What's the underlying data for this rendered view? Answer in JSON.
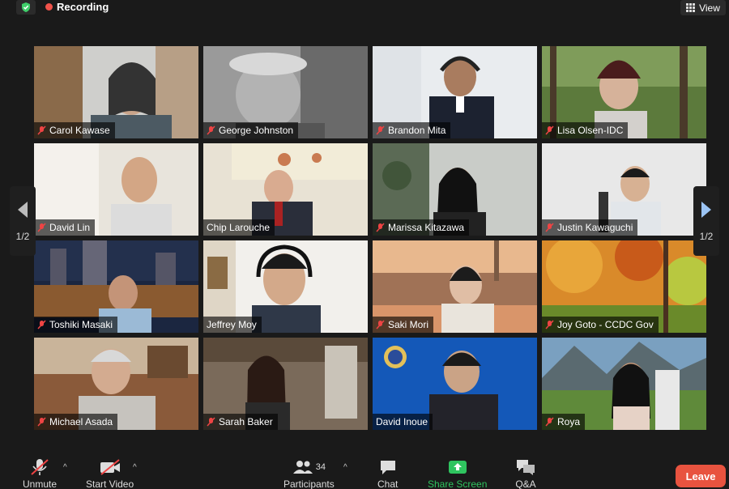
{
  "topbar": {
    "recording_label": "Recording",
    "view_label": "View",
    "security_icon": "shield-check-icon"
  },
  "pagination": {
    "left": "1/2",
    "right": "1/2"
  },
  "participants_grid": [
    {
      "name": "Carol Kawase",
      "muted": true
    },
    {
      "name": "George Johnston",
      "muted": true
    },
    {
      "name": "Brandon Mita",
      "muted": true
    },
    {
      "name": "Lisa Olsen-IDC",
      "muted": true
    },
    {
      "name": "David Lin",
      "muted": true
    },
    {
      "name": "Chip Larouche",
      "muted": false
    },
    {
      "name": "Marissa Kitazawa",
      "muted": true
    },
    {
      "name": "Justin Kawaguchi",
      "muted": true
    },
    {
      "name": "Toshiki Masaki",
      "muted": true
    },
    {
      "name": "Jeffrey Moy",
      "muted": false,
      "active_speaker": true
    },
    {
      "name": "Saki Mori",
      "muted": true
    },
    {
      "name": "Joy Goto - CCDC Gov",
      "muted": true
    },
    {
      "name": "Michael Asada",
      "muted": true
    },
    {
      "name": "Sarah Baker",
      "muted": true
    },
    {
      "name": "David Inoue",
      "muted": false
    },
    {
      "name": "Roya",
      "muted": true
    }
  ],
  "toolbar": {
    "unmute": "Unmute",
    "start_video": "Start Video",
    "participants": "Participants",
    "participants_count": "34",
    "chat": "Chat",
    "share_screen": "Share Screen",
    "qa": "Q&A",
    "leave": "Leave"
  },
  "colors": {
    "share_green": "#2fc45f",
    "leave_red": "#e8533f",
    "recording_red": "#f0524a",
    "active_speaker_border": "#f2f2a0"
  }
}
